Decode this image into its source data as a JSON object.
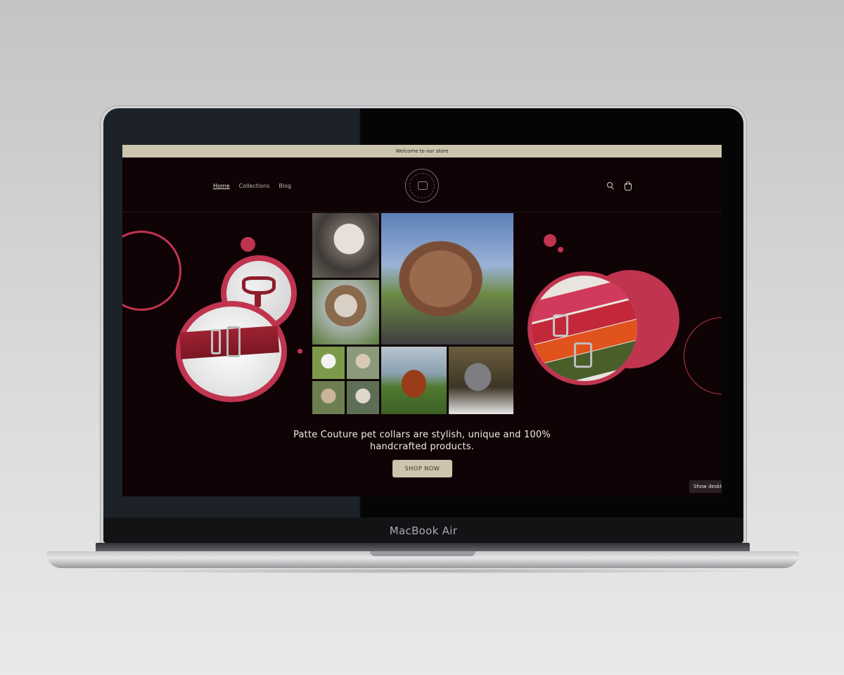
{
  "device": {
    "label": "MacBook Air"
  },
  "announcement": {
    "text": "Welcome to our store"
  },
  "nav": {
    "items": [
      {
        "label": "Home",
        "active": true
      },
      {
        "label": "Collections",
        "active": false
      },
      {
        "label": "Blog",
        "active": false
      }
    ]
  },
  "header": {
    "icons": [
      "search-icon",
      "cart-icon"
    ],
    "logo": "patte-couture-logo"
  },
  "hero": {
    "tagline_line1": "Patte Couture pet collars are stylish, unique and 100%",
    "tagline_line2": "handcrafted products.",
    "cta_label": "SHOP NOW"
  },
  "floating": {
    "show_desktop_label": "Show desktop"
  },
  "colors": {
    "accent": "#c0344f",
    "announcement_bg": "#ccc4ad",
    "page_bg": "#0f0306"
  }
}
